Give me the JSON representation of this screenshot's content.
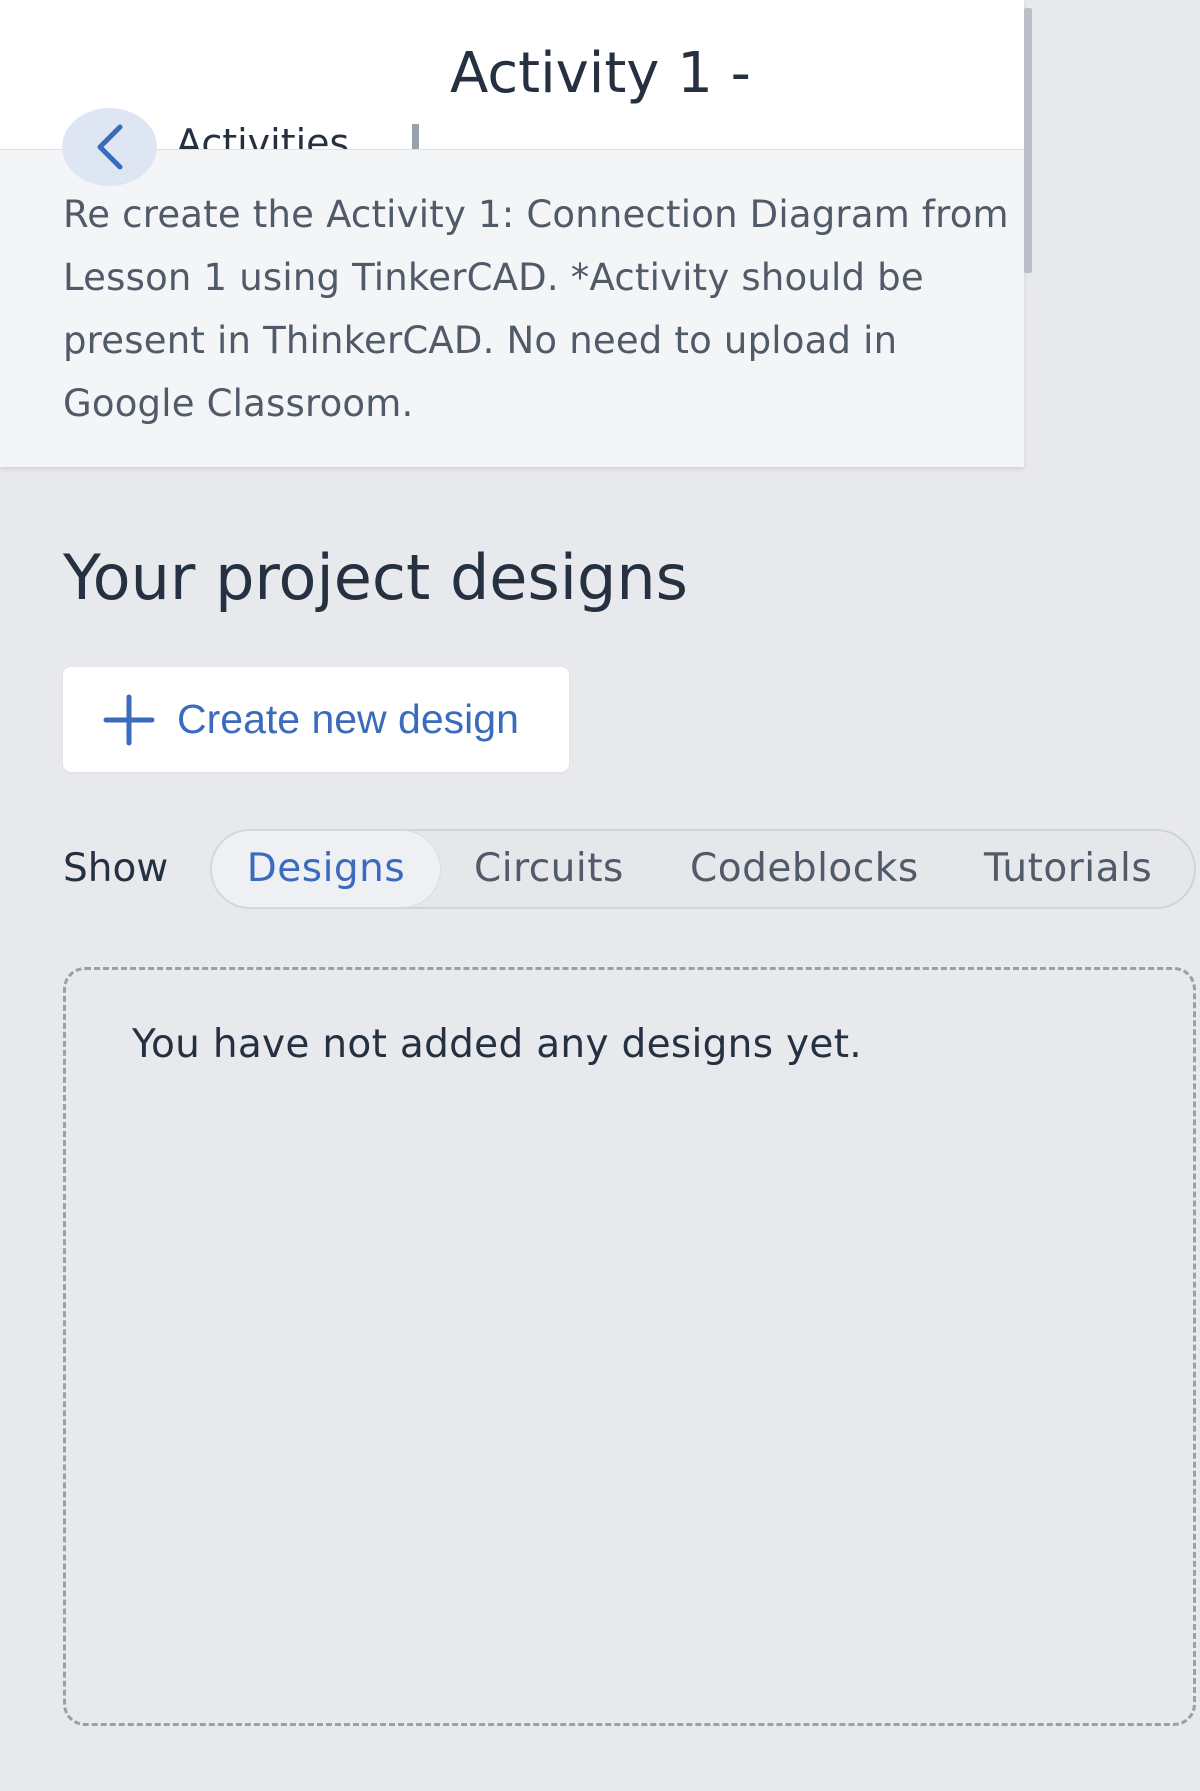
{
  "header": {
    "title": "Activity 1 -",
    "breadcrumb": "Activities",
    "description": "Re create the Activity 1: Connection Diagram from Lesson 1 using TinkerCAD. *Activity should be present in ThinkerCAD. No need to upload in Google Classroom."
  },
  "projects": {
    "section_title": "Your project designs",
    "create_button_label": "Create new design",
    "show_label": "Show",
    "tabs": [
      {
        "label": "Designs",
        "active": true
      },
      {
        "label": "Circuits",
        "active": false
      },
      {
        "label": "Codeblocks",
        "active": false
      },
      {
        "label": "Tutorials",
        "active": false
      }
    ],
    "empty_message": "You have not added any designs yet."
  },
  "icons": {
    "back": "chevron-left-icon",
    "create": "plus-icon"
  },
  "colors": {
    "accent": "#3a6bbd",
    "page_background": "#e8e9ed",
    "text_primary": "#253041"
  }
}
